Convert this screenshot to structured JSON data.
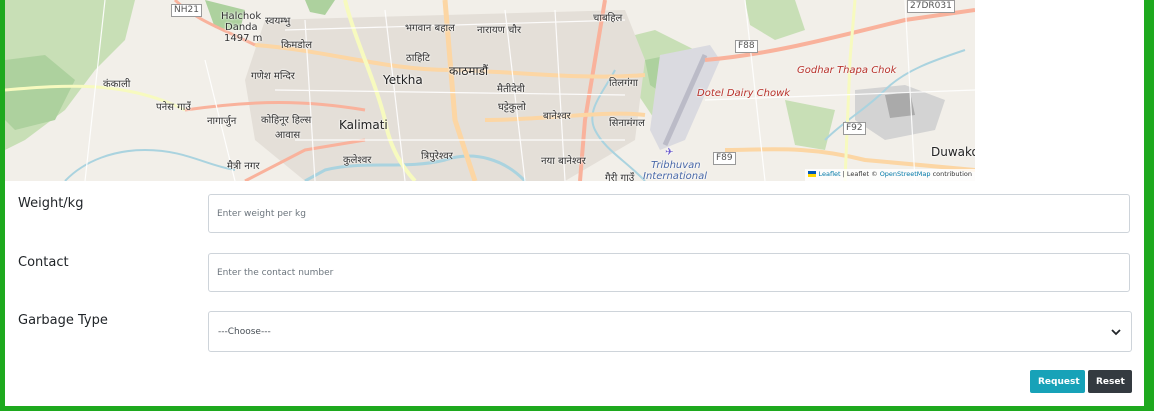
{
  "map": {
    "labels": {
      "nh21": "NH21",
      "halchok": "Halchok",
      "danda": "Danda",
      "elevation": "1497 m",
      "swayambhu": "स्वयम्भु",
      "kimdol": "किमडोल",
      "bhagwanbahal": "भगवान बहाल",
      "narayanchaur": "नारायण चौर",
      "chabahil": "चाबहिल",
      "f88": "F88",
      "shield_27dr031": "27DR031",
      "thahiti": "ठाहिटि",
      "ganeshmandir": "गणेश मन्दिर",
      "kankali": "कंकाली",
      "yetkha": "Yetkha",
      "kathmandu": "काठमाडौं",
      "maitidevi": "मैतीदेवी",
      "tilganga": "तिलगंगा",
      "godhar": "Godhar Thapa Chok",
      "panchagaun": "पनेस गाउँ",
      "nagarjun": "नागार्जुन",
      "kohinoor": "कोहिनूर हिल्स",
      "awas": "आवास",
      "kalimati": "Kalimati",
      "ghattekulo": "घट्टेकुलो",
      "baneshwor": "बानेश्वर",
      "sinamangal": "सिनामंगल",
      "doteldairy": "Dotel Dairy Chowk",
      "f92": "F92",
      "duwakot": "Duwakot",
      "maitinagar": "मैत्री नगर",
      "kuleshwor": "कुलेश्वर",
      "tripureshwor": "त्रिपुरेश्वर",
      "nayabaneshwor": "नया बानेश्वर",
      "tribhuvan": "Tribhuvan",
      "international": "International",
      "f89": "F89",
      "gairigaun": "गैरी गाउँ"
    },
    "attribution": {
      "leaflet": "Leaflet",
      "sep": " | Leaflet © ",
      "osm": "OpenStreetMap",
      "contrib": " contribution"
    }
  },
  "form": {
    "weight": {
      "label": "Weight/kg",
      "placeholder": "Enter weight per kg"
    },
    "contact": {
      "label": "Contact",
      "placeholder": "Enter the contact number"
    },
    "garbage": {
      "label": "Garbage Type",
      "selected": "---Choose---"
    },
    "request_label": "Request",
    "reset_label": "Reset"
  },
  "colors": {
    "border_green": "#1ea91e",
    "request_btn": "#17a2b8",
    "reset_btn": "#343a40"
  }
}
